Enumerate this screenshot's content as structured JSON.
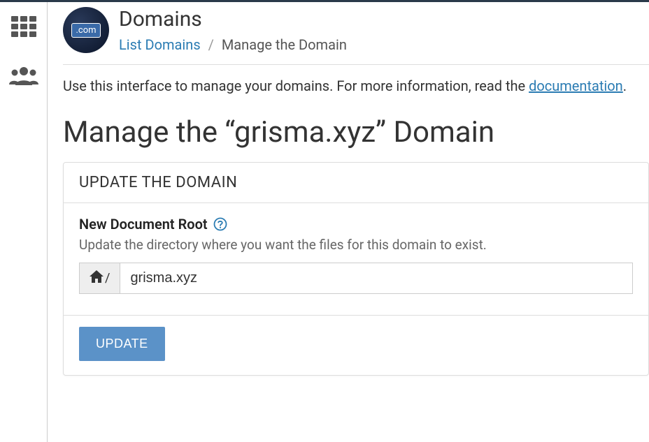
{
  "header": {
    "title": "Domains",
    "icon_text": ".com"
  },
  "breadcrumb": {
    "link_label": "List Domains",
    "current": "Manage the Domain"
  },
  "intro": {
    "text_pre": "Use this interface to manage your domains. For more information, read the ",
    "doc_link": "documentation",
    "text_post": "."
  },
  "page_title": "Manage the “grisma.xyz” Domain",
  "panel": {
    "header": "UPDATE THE DOMAIN",
    "field_label": "New Document Root",
    "field_desc": "Update the directory where you want the files for this domain to exist.",
    "addon_suffix": "/",
    "input_value": "grisma.xyz",
    "update_btn": "UPDATE"
  }
}
